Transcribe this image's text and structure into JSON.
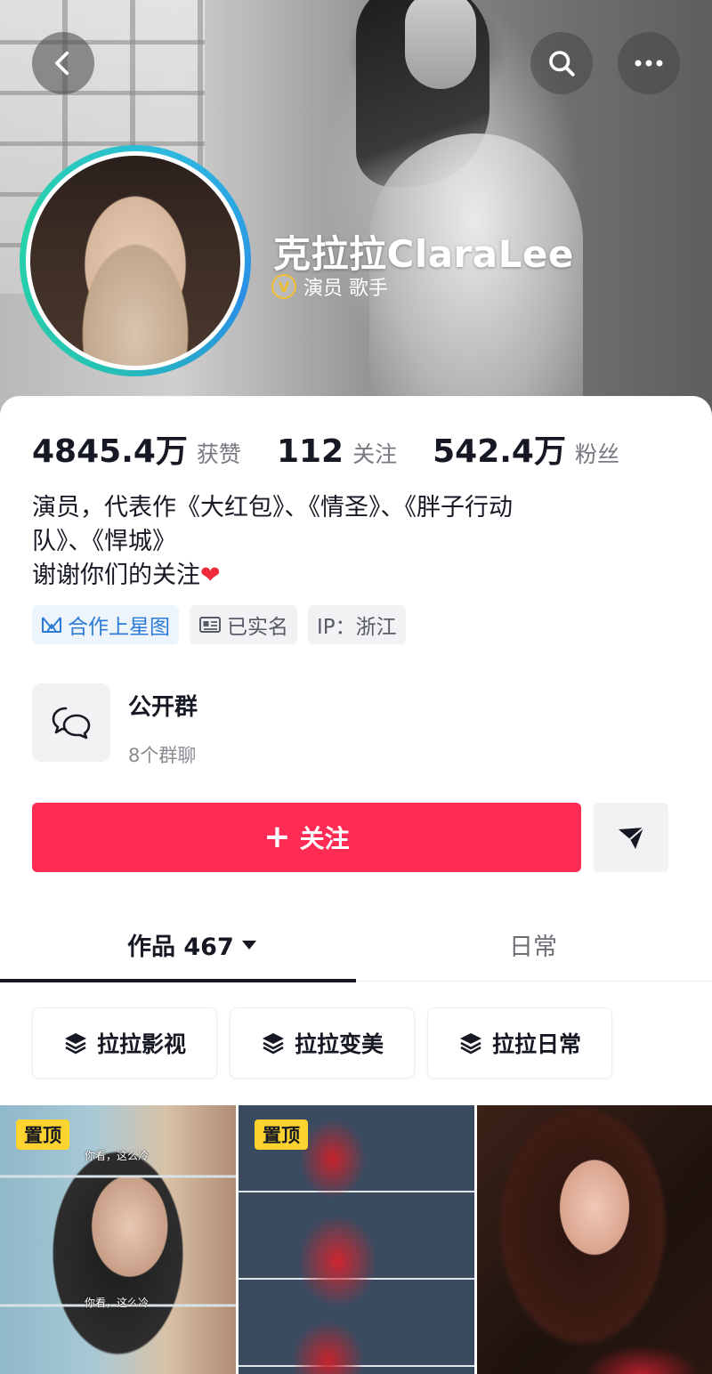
{
  "header": {
    "name": "克拉拉ClaraLee",
    "verified_icon": "verified-v-icon",
    "verified_text": "演员 歌手",
    "back_icon": "back-chevron-icon",
    "search_icon": "search-icon",
    "more_icon": "more-dots-icon"
  },
  "stats": [
    {
      "value": "4845.4万",
      "label": "获赞"
    },
    {
      "value": "112",
      "label": "关注"
    },
    {
      "value": "542.4万",
      "label": "粉丝"
    }
  ],
  "bio": {
    "line1": "演员，代表作《大红包》、《情圣》、《胖子行动",
    "line2": "队》、《悍城》",
    "line3": "谢谢你们的关注",
    "heart": "❤"
  },
  "tags": [
    {
      "label": "合作上星图",
      "icon": "star-map-icon"
    },
    {
      "label": "已实名",
      "icon": "id-card-icon"
    },
    {
      "label": "IP：浙江"
    }
  ],
  "group": {
    "icon": "chat-bubbles-icon",
    "title": "公开群",
    "subtitle": "8个群聊"
  },
  "actions": {
    "follow_label": "关注",
    "follow_plus": "+",
    "share_icon": "send-icon"
  },
  "tabs": [
    {
      "label": "作品 467",
      "active": true
    },
    {
      "label": "日常",
      "active": false
    }
  ],
  "collections": [
    {
      "label": "拉拉影视",
      "icon": "layers-icon"
    },
    {
      "label": "拉拉变美",
      "icon": "layers-icon"
    },
    {
      "label": "拉拉日常",
      "icon": "layers-icon"
    }
  ],
  "videos": [
    {
      "pinned": "置顶",
      "subtitle_top": "你看，这么冷",
      "subtitle_mid": "你看，这么冷"
    },
    {
      "pinned": "置顶"
    },
    {}
  ],
  "colors": {
    "accent": "#fe2c55",
    "pin": "#fdd330",
    "verified": "#f0c030",
    "tag_blue": "#2b7ad7"
  }
}
